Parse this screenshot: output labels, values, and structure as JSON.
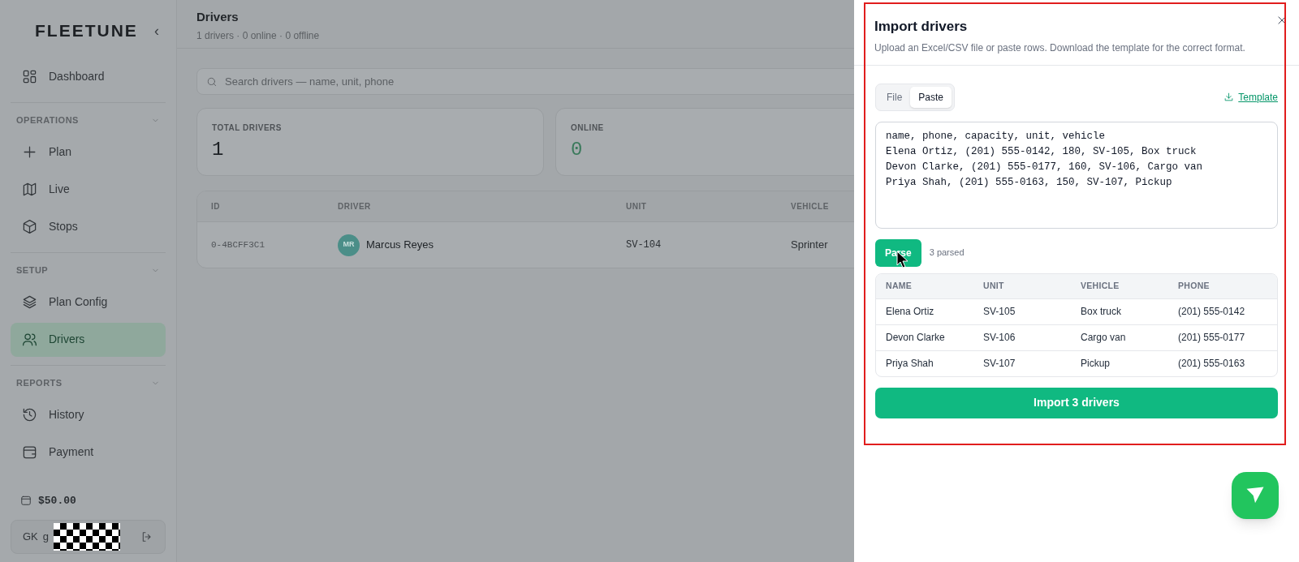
{
  "sidebar": {
    "logo": "FLEETUNE",
    "collapse": "‹",
    "top_items": [
      {
        "label": "Dashboard",
        "selected": false
      }
    ],
    "sections": [
      {
        "title": "OPERATIONS",
        "expanded": true,
        "items": [
          {
            "label": "Plan",
            "selected": false
          },
          {
            "label": "Live",
            "selected": false
          },
          {
            "label": "Stops",
            "selected": false
          }
        ]
      },
      {
        "title": "SETUP",
        "expanded": true,
        "items": [
          {
            "label": "Plan Config",
            "selected": false
          },
          {
            "label": "Drivers",
            "selected": true
          }
        ]
      },
      {
        "title": "REPORTS",
        "expanded": true,
        "items": [
          {
            "label": "History",
            "selected": false
          },
          {
            "label": "Payment",
            "selected": false
          }
        ]
      }
    ],
    "balance": "$50.00",
    "user": {
      "initials": "GK",
      "name_visible": "g"
    }
  },
  "header": {
    "title": "Drivers",
    "subtitle": "1 drivers · 0 online · 0 offline"
  },
  "search": {
    "placeholder": "Search drivers — name, unit, phone"
  },
  "stats": [
    {
      "label": "TOTAL DRIVERS",
      "value": "1",
      "kind": "plain"
    },
    {
      "label": "ONLINE",
      "value": "0",
      "kind": "online"
    }
  ],
  "table": {
    "columns": [
      "ID",
      "DRIVER",
      "UNIT",
      "VEHICLE"
    ],
    "rows": [
      {
        "id": "0-4BCFF3C1",
        "initials": "MR",
        "driver": "Marcus Reyes",
        "unit": "SV-104",
        "vehicle": "Sprinter"
      }
    ]
  },
  "drawer": {
    "title": "Import drivers",
    "description": "Upload an Excel/CSV file or paste rows. Download the template for the correct format.",
    "tabs": [
      {
        "label": "File",
        "selected": false
      },
      {
        "label": "Paste",
        "selected": true
      }
    ],
    "template_link": "Template",
    "paste_lines": [
      "name, phone, capacity, unit, vehicle",
      "Elena Ortiz, (201) 555-0142, 180, SV-105, Box truck",
      "Devon Clarke, (201) 555-0177, 160, SV-106, Cargo van",
      "Priya Shah, (201) 555-0163, 150, SV-107, Pickup"
    ],
    "parse_button": "Parse",
    "parsed_count": "3 parsed",
    "preview": {
      "columns": [
        "NAME",
        "UNIT",
        "VEHICLE",
        "PHONE"
      ],
      "rows": [
        [
          "Elena Ortiz",
          "SV-105",
          "Box truck",
          "(201) 555-0142"
        ],
        [
          "Devon Clarke",
          "SV-106",
          "Cargo van",
          "(201) 555-0177"
        ],
        [
          "Priya Shah",
          "SV-107",
          "Pickup",
          "(201) 555-0163"
        ]
      ]
    },
    "import_button": "Import 3 drivers"
  }
}
